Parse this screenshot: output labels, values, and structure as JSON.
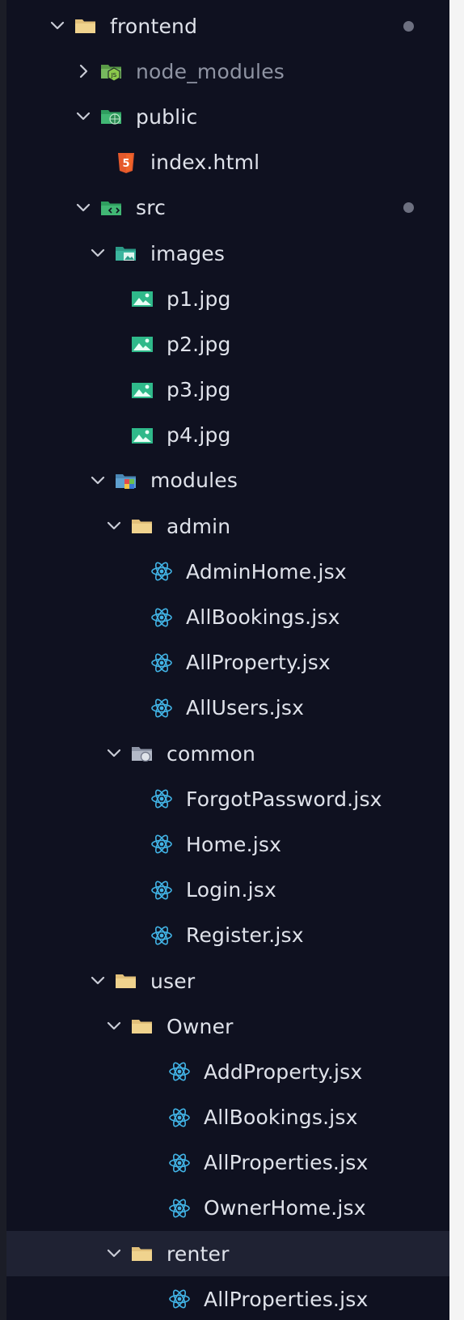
{
  "explorer": {
    "items": [
      {
        "label": "frontend",
        "kind": "folder",
        "expanded": true,
        "depth": 0,
        "modified": true
      },
      {
        "label": "node_modules",
        "kind": "node-folder",
        "expanded": false,
        "depth": 1,
        "dim": true
      },
      {
        "label": "public",
        "kind": "public-folder",
        "expanded": true,
        "depth": 1
      },
      {
        "label": "index.html",
        "kind": "html",
        "depth": 2
      },
      {
        "label": "src",
        "kind": "src-folder",
        "expanded": true,
        "depth": 1,
        "modified": true
      },
      {
        "label": "images",
        "kind": "images-folder",
        "expanded": true,
        "depth": 2
      },
      {
        "label": "p1.jpg",
        "kind": "image",
        "depth": 3
      },
      {
        "label": "p2.jpg",
        "kind": "image",
        "depth": 3
      },
      {
        "label": "p3.jpg",
        "kind": "image",
        "depth": 3
      },
      {
        "label": "p4.jpg",
        "kind": "image",
        "depth": 3
      },
      {
        "label": "modules",
        "kind": "modules-folder",
        "expanded": true,
        "depth": 2
      },
      {
        "label": "admin",
        "kind": "folder",
        "expanded": true,
        "depth": 3
      },
      {
        "label": "AdminHome.jsx",
        "kind": "react",
        "depth": 4
      },
      {
        "label": "AllBookings.jsx",
        "kind": "react",
        "depth": 4
      },
      {
        "label": "AllProperty.jsx",
        "kind": "react",
        "depth": 4
      },
      {
        "label": "AllUsers.jsx",
        "kind": "react",
        "depth": 4
      },
      {
        "label": "common",
        "kind": "common-folder",
        "expanded": true,
        "depth": 3
      },
      {
        "label": "ForgotPassword.jsx",
        "kind": "react",
        "depth": 4
      },
      {
        "label": "Home.jsx",
        "kind": "react",
        "depth": 4
      },
      {
        "label": "Login.jsx",
        "kind": "react",
        "depth": 4
      },
      {
        "label": "Register.jsx",
        "kind": "react",
        "depth": 4
      },
      {
        "label": "user",
        "kind": "folder",
        "expanded": true,
        "depth": 2
      },
      {
        "label": "Owner",
        "kind": "folder",
        "expanded": true,
        "depth": 3
      },
      {
        "label": "AddProperty.jsx",
        "kind": "react",
        "depth": 5
      },
      {
        "label": "AllBookings.jsx",
        "kind": "react",
        "depth": 5
      },
      {
        "label": "AllProperties.jsx",
        "kind": "react",
        "depth": 5
      },
      {
        "label": "OwnerHome.jsx",
        "kind": "react",
        "depth": 5
      },
      {
        "label": "renter",
        "kind": "folder",
        "expanded": true,
        "depth": 3,
        "selected": true
      },
      {
        "label": "AllProperties.jsx",
        "kind": "react",
        "depth": 5
      }
    ]
  },
  "icons": {
    "folder": "folder-icon",
    "node-folder": "node-modules-folder-icon",
    "public-folder": "public-folder-icon",
    "src-folder": "src-folder-icon",
    "images-folder": "images-folder-icon",
    "modules-folder": "modules-folder-icon",
    "common-folder": "common-folder-icon",
    "html": "html5-icon",
    "image": "image-file-icon",
    "react": "react-icon"
  },
  "colors": {
    "background": "#0f1120",
    "text": "#dfe2ea",
    "dim_text": "#8f94a3",
    "folder": "#e2c07a",
    "html": "#e4592c",
    "image": "#2fb98a",
    "react": "#42b4e6",
    "modified_dot": "#6d7080",
    "selected_row": "#1f2233"
  }
}
